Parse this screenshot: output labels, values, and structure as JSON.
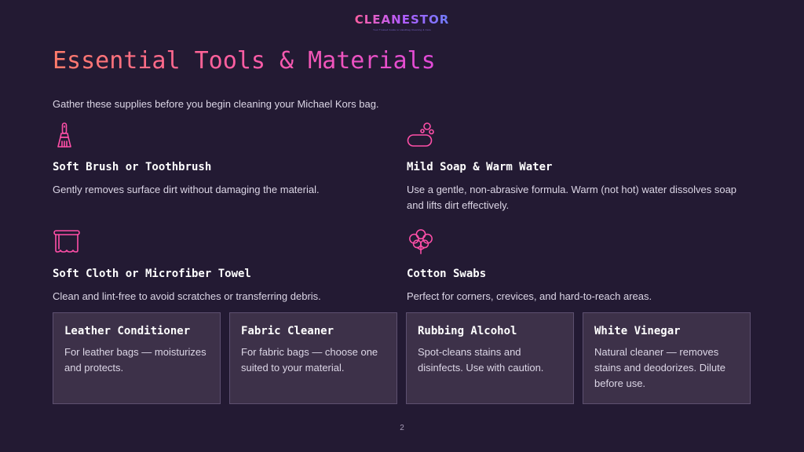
{
  "brand": {
    "name": "CLEANESTOR",
    "tagline": "Your Trusted Guide to Handbag Cleaning & Care"
  },
  "slide": {
    "title": "Essential Tools & Materials",
    "subtitle": "Gather these supplies before you begin cleaning your Michael Kors bag.",
    "page_number": "2"
  },
  "tools": [
    {
      "icon": "brush-icon",
      "title": "Soft Brush or Toothbrush",
      "desc": "Gently removes surface dirt without damaging the material."
    },
    {
      "icon": "soap-bubbles-icon",
      "title": "Mild Soap & Warm Water",
      "desc": "Use a gentle, non-abrasive formula. Warm (not hot) water dissolves soap and lifts dirt effectively."
    },
    {
      "icon": "towel-icon",
      "title": "Soft Cloth or Microfiber Towel",
      "desc": "Clean and lint-free to avoid scratches or transferring debris."
    },
    {
      "icon": "cotton-icon",
      "title": "Cotton Swabs",
      "desc": "Perfect for corners, crevices, and hard-to-reach areas."
    }
  ],
  "cards": [
    {
      "title": "Leather Conditioner",
      "desc": "For leather bags — moisturizes and protects."
    },
    {
      "title": "Fabric Cleaner",
      "desc": "For fabric bags — choose one suited to your material."
    },
    {
      "title": "Rubbing Alcohol",
      "desc": "Spot-cleans stains and disinfects. Use with caution."
    },
    {
      "title": "White Vinegar",
      "desc": "Natural cleaner — removes stains and deodorizes. Dilute before use."
    }
  ],
  "colors": {
    "background": "#231a33",
    "accent_pink": "#ff4fa8",
    "accent_coral": "#ff7c6a",
    "card_bg": "#3d3149"
  }
}
